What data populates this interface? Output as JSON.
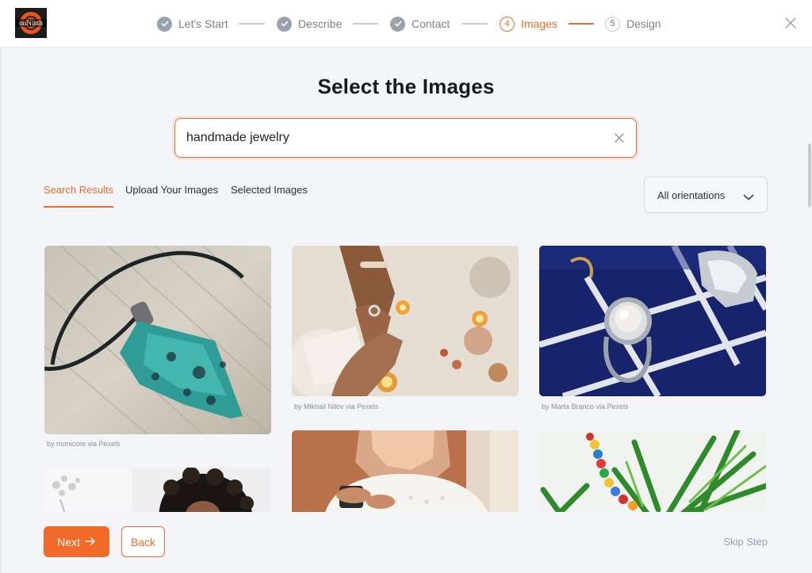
{
  "brand": {
    "logo_text": "onNinth"
  },
  "steps": [
    {
      "number": "1",
      "label": "Let's Start",
      "state": "done"
    },
    {
      "number": "2",
      "label": "Describe",
      "state": "done"
    },
    {
      "number": "3",
      "label": "Contact",
      "state": "done"
    },
    {
      "number": "4",
      "label": "Images",
      "state": "active"
    },
    {
      "number": "5",
      "label": "Design",
      "state": "todo"
    }
  ],
  "title": "Select the Images",
  "search": {
    "value": "handmade jewelry",
    "placeholder": ""
  },
  "tabs": [
    {
      "label": "Search Results",
      "active": true
    },
    {
      "label": "Upload Your Images",
      "active": false
    },
    {
      "label": "Selected Images",
      "active": false
    }
  ],
  "orientation": {
    "selected": "All orientations"
  },
  "images": [
    {
      "subject": "turquoise stone pendant on leather cord",
      "credit": "by monicore via Pexels"
    },
    {
      "subject": "hands with rings and candles",
      "credit": "by Mikhail Nilov via Pexels"
    },
    {
      "subject": "pearl ring on navy display tray",
      "credit": "by Marta Branco via Pexels"
    },
    {
      "subject": "woman with curly hair",
      "credit": ""
    },
    {
      "subject": "woman in hijab holding jewelry",
      "credit": ""
    },
    {
      "subject": "beaded bracelet on palm leaves",
      "credit": ""
    }
  ],
  "footer": {
    "next_label": "Next",
    "back_label": "Back",
    "skip_label": "Skip Step"
  },
  "colors": {
    "accent": "#f26b2a",
    "done_step": "#9aa3ad",
    "background": "#f3f5f8"
  }
}
